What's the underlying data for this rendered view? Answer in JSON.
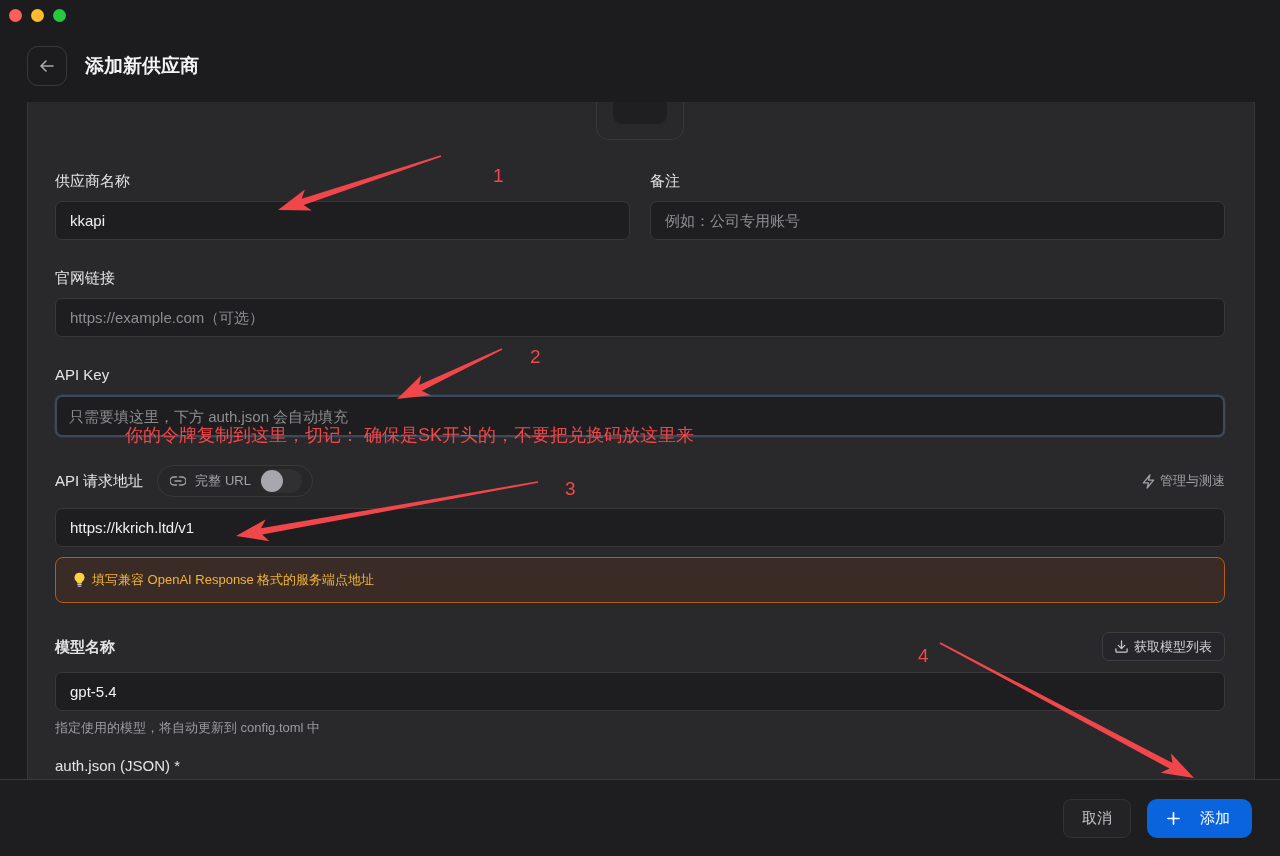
{
  "header": {
    "title": "添加新供应商"
  },
  "provider_name": {
    "label": "供应商名称",
    "value": "kkapi"
  },
  "note": {
    "label": "备注",
    "placeholder": "例如：公司专用账号"
  },
  "website": {
    "label": "官网链接",
    "placeholder": "https://example.com（可选）"
  },
  "api_key": {
    "label": "API Key",
    "placeholder": "只需要填这里，下方 auth.json 会自动填充",
    "focused": true
  },
  "endpoint": {
    "label": "API 请求地址",
    "full_url_toggle": {
      "label": "完整 URL",
      "on": false
    },
    "manage_link": "管理与测速",
    "value": "https://kkrich.ltd/v1",
    "hint": "填写兼容 OpenAI Response 格式的服务端点地址"
  },
  "model": {
    "label": "模型名称",
    "fetch_button": "获取模型列表",
    "value": "gpt-5.4",
    "help": "指定使用的模型，将自动更新到 config.toml 中"
  },
  "auth_json": {
    "label": "auth.json (JSON) *"
  },
  "footer": {
    "buttons": [
      {
        "label": "取消",
        "kind": "secondary"
      },
      {
        "label": "添加",
        "kind": "primary"
      }
    ]
  },
  "annotations": {
    "note": "你的令牌复制到这里，切记： 确保是SK开头的，不要把兑换码放这里来",
    "markers": [
      {
        "number": "1"
      },
      {
        "number": "2"
      },
      {
        "number": "3"
      },
      {
        "number": "4"
      }
    ]
  }
}
